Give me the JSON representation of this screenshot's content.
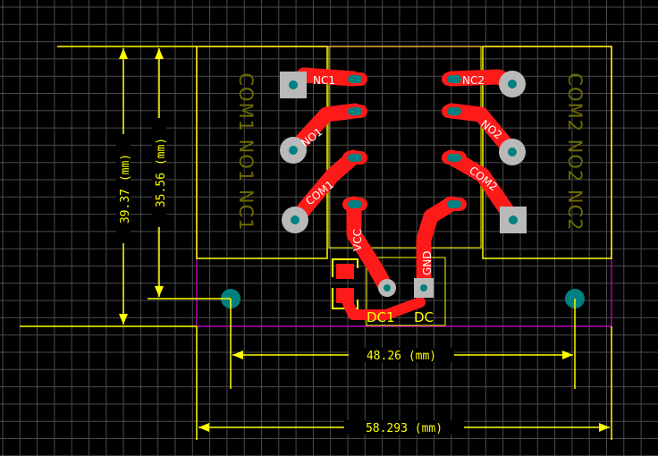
{
  "dimensions": {
    "outer_height": "39.37 (mm)",
    "inner_height": "35.56 (mm)",
    "hole_spacing": "48.26 (mm)",
    "board_width": "58.293 (mm)"
  },
  "pad_labels": {
    "nc1": "NC1",
    "no1": "NO1",
    "com1": "COM1",
    "vcc": "VCC",
    "nc2": "NC2",
    "no2": "NO2",
    "com2": "COM2",
    "gnd": "GND"
  },
  "terminal_labels": {
    "left": "COM1 NO1 NC1",
    "right": "COM2 NO2 NC2"
  },
  "designators": {
    "connector": "DC1",
    "connector_dup": "DC"
  },
  "colors": {
    "background": "#000000",
    "grid": "#4a4a4a",
    "dimension": "#ffff00",
    "copper": "#ff1a1a",
    "board_outline": "#b000b0",
    "mount_hole": "#008080",
    "pad": "#b9b9b9"
  }
}
